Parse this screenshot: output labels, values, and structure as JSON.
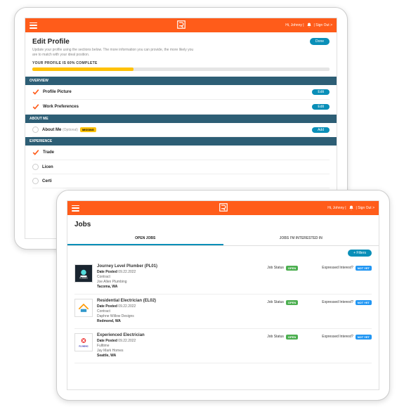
{
  "header": {
    "greeting": "Hi, Johnny |",
    "signout": "| Sign Out >"
  },
  "profile": {
    "title": "Edit Profile",
    "subtitle": "Update your profile using the sections below. The more information you can provide, the more likely you are to match with your ideal position.",
    "done": "Done",
    "progress_label": "YOUR PROFILE IS 60% COMPLETE",
    "progress_pct": 60,
    "sections": {
      "overview": "OVERVIEW",
      "about": "ABOUT ME",
      "experience": "EXPERIENCE"
    },
    "rows": {
      "pic": "Profile Picture",
      "pref": "Work Preferences",
      "about": "About Me",
      "about_opt": "(Optional)",
      "missing": "MISSING",
      "trades": "Trade",
      "licen": "Licen",
      "certi": "Certi"
    },
    "buttons": {
      "edit": "Edit",
      "add": "Add"
    }
  },
  "jobs": {
    "title": "Jobs",
    "tabs": {
      "open": "OPEN JOBS",
      "interested": "JOBS I'M INTERESTED IN"
    },
    "filters": "+ Filters",
    "status_label": "Job Status",
    "status_open": "OPEN",
    "interest_label": "Expressed Interest?",
    "notyet": "NOT YET",
    "date_prefix": "Date Posted",
    "list": [
      {
        "title": "Journey Level Plumber (PL01)",
        "date": "09.22.2022",
        "type": "Contract",
        "company": "Joe Allen Plumbing",
        "loc": "Tacoma, WA"
      },
      {
        "title": "Residential Electrician (EL02)",
        "date": "09.22.2022",
        "type": "Contract",
        "company": "Daphne Willow Designs",
        "loc": "Redmond, WA"
      },
      {
        "title": "Experienced Electrician",
        "date": "09.22.2022",
        "type": "Fulltime",
        "company": "Jay Mark Homes",
        "loc": "Seattle, WA"
      }
    ]
  }
}
